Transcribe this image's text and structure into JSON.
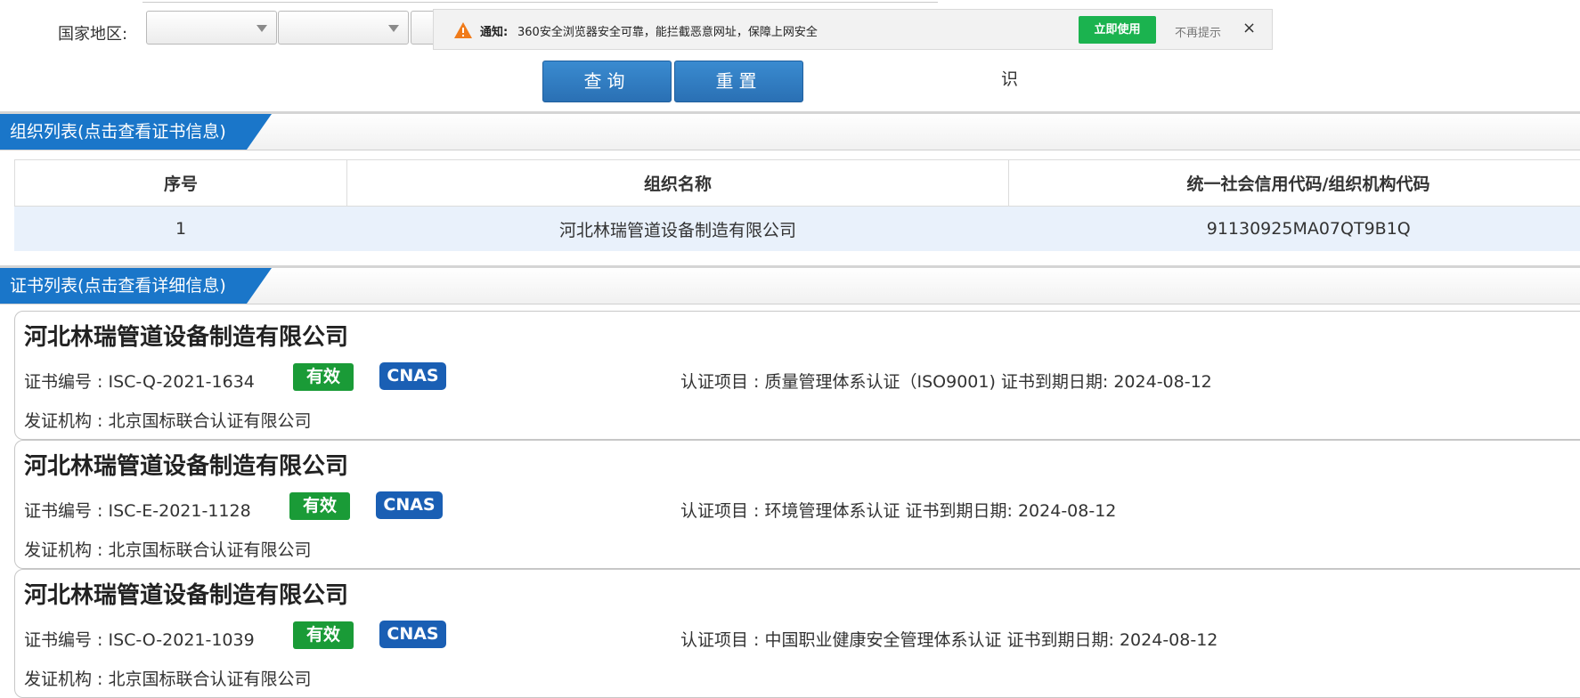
{
  "form": {
    "country_label": "国家地区:",
    "query_button": "查询",
    "reset_button": "重置",
    "stray_text": "识"
  },
  "notification": {
    "title": "通知:",
    "message": "360安全浏览器安全可靠，能拦截恶意网址，保障上网安全",
    "use_button": "立即使用",
    "dismiss": "不再提示",
    "close": "×"
  },
  "org_section": {
    "title": "组织列表(点击查看证书信息)",
    "columns": [
      "序号",
      "组织名称",
      "统一社会信用代码/组织机构代码"
    ],
    "rows": [
      [
        "1",
        "河北林瑞管道设备制造有限公司",
        "91130925MA07QT9B1Q"
      ]
    ]
  },
  "cert_section": {
    "title": "证书列表(点击查看详细信息)",
    "items": [
      {
        "company": "河北林瑞管道设备制造有限公司",
        "cert_no": "证书编号 : ISC-Q-2021-1634",
        "status": "有效",
        "accreditation": "CNAS",
        "project": "认证项目 : 质量管理体系认证（ISO9001)     证书到期日期: 2024-08-12",
        "issuer": "发证机构 : 北京国标联合认证有限公司"
      },
      {
        "company": "河北林瑞管道设备制造有限公司",
        "cert_no": "证书编号 : ISC-E-2021-1128",
        "status": "有效",
        "accreditation": "CNAS",
        "project": "认证项目 : 环境管理体系认证   证书到期日期: 2024-08-12",
        "issuer": "发证机构 : 北京国标联合认证有限公司"
      },
      {
        "company": "河北林瑞管道设备制造有限公司",
        "cert_no": "证书编号 : ISC-O-2021-1039",
        "status": "有效",
        "accreditation": "CNAS",
        "project": "认证项目 : 中国职业健康安全管理体系认证   证书到期日期: 2024-08-12",
        "issuer": "发证机构 : 北京国标联合认证有限公司"
      }
    ]
  },
  "colors": {
    "primary_blue": "#1a76c9",
    "valid_green": "#1a9b37",
    "cnas_blue": "#1a5fb4",
    "notify_green": "#1bb34f",
    "row_highlight": "#e9f1fb"
  }
}
